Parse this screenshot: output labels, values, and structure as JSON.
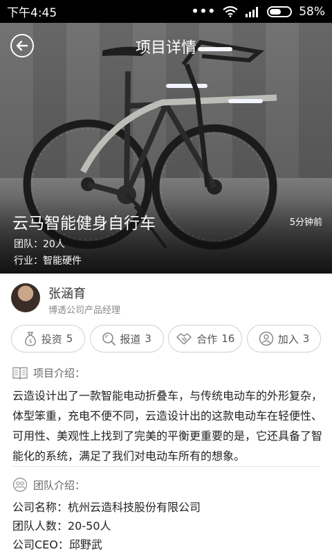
{
  "status_bar": {
    "time": "下午4:45",
    "battery": "58%",
    "battery_level": 0.58
  },
  "header": {
    "title": "项目详情"
  },
  "project": {
    "name": "云马智能健身自行车",
    "time_ago": "5分钟前",
    "team": "团队：20人",
    "industry": "行业：智能硬件"
  },
  "author": {
    "name": "张涵育",
    "title": "博透公司产品经理"
  },
  "actions": [
    {
      "label": "投资",
      "count": "5",
      "icon": "money-bag-icon"
    },
    {
      "label": "报道",
      "count": "3",
      "icon": "search-icon"
    },
    {
      "label": "合作",
      "count": "16",
      "icon": "handshake-icon"
    },
    {
      "label": "加入",
      "count": "3",
      "icon": "person-add-icon"
    }
  ],
  "intro": {
    "heading": "项目介绍：",
    "text": "云造设计出了一款智能电动折叠车，与传统电动车的外形复杂，体型笨重，充电不便不同，云造设计出的这款电动车在轻便性、可用性、美观性上找到了完美的平衡更重要的是，它还具备了智能化的系统，满足了我们对电动车所有的想象。"
  },
  "team": {
    "heading": "团队介绍：",
    "lines": [
      "公司名称：杭州云造科技股份有限公司",
      "团队人数：20-50人",
      "公司CEO：邱野武"
    ]
  }
}
